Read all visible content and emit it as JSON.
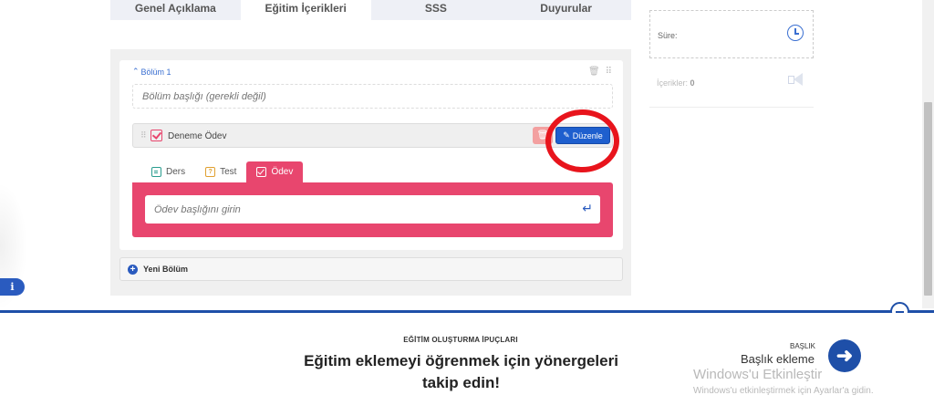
{
  "tabs": [
    {
      "label": "Genel Açıklama"
    },
    {
      "label": "Eğitim İçerikleri"
    },
    {
      "label": "SSS"
    },
    {
      "label": "Duyurular"
    }
  ],
  "section": {
    "label": "Bölüm 1",
    "title_placeholder": "Bölüm başlığı (gerekli değil)",
    "item": {
      "name": "Deneme Ödev",
      "edit_label": "Düzenle"
    },
    "type_tabs": [
      {
        "label": "Ders",
        "icon": "document-icon"
      },
      {
        "label": "Test",
        "icon": "question-icon"
      },
      {
        "label": "Ödev",
        "icon": "checkbox-icon"
      }
    ],
    "assignment_placeholder": "Ödev başlığını girin",
    "new_section_label": "Yeni Bölüm"
  },
  "sidebar": {
    "duration_label": "Süre:",
    "contents_label": "İçerikler:",
    "contents_count": "0"
  },
  "tips": {
    "heading": "EĞİTİM OLUŞTURMA İPUÇLARI",
    "text": "Eğitim eklemeyi öğrenmek için yönergeleri takip edin!",
    "next_small": "BAŞLIK",
    "next_title": "Başlık ekleme"
  },
  "watermark": {
    "title": "Windows'u Etkinleştir",
    "subtitle": "Windows'u etkinleştirmek için Ayarlar'a gidin."
  },
  "colors": {
    "accent_blue": "#1e5fce",
    "assignment_pink": "#e8466e",
    "highlight_red": "#e8141c"
  }
}
